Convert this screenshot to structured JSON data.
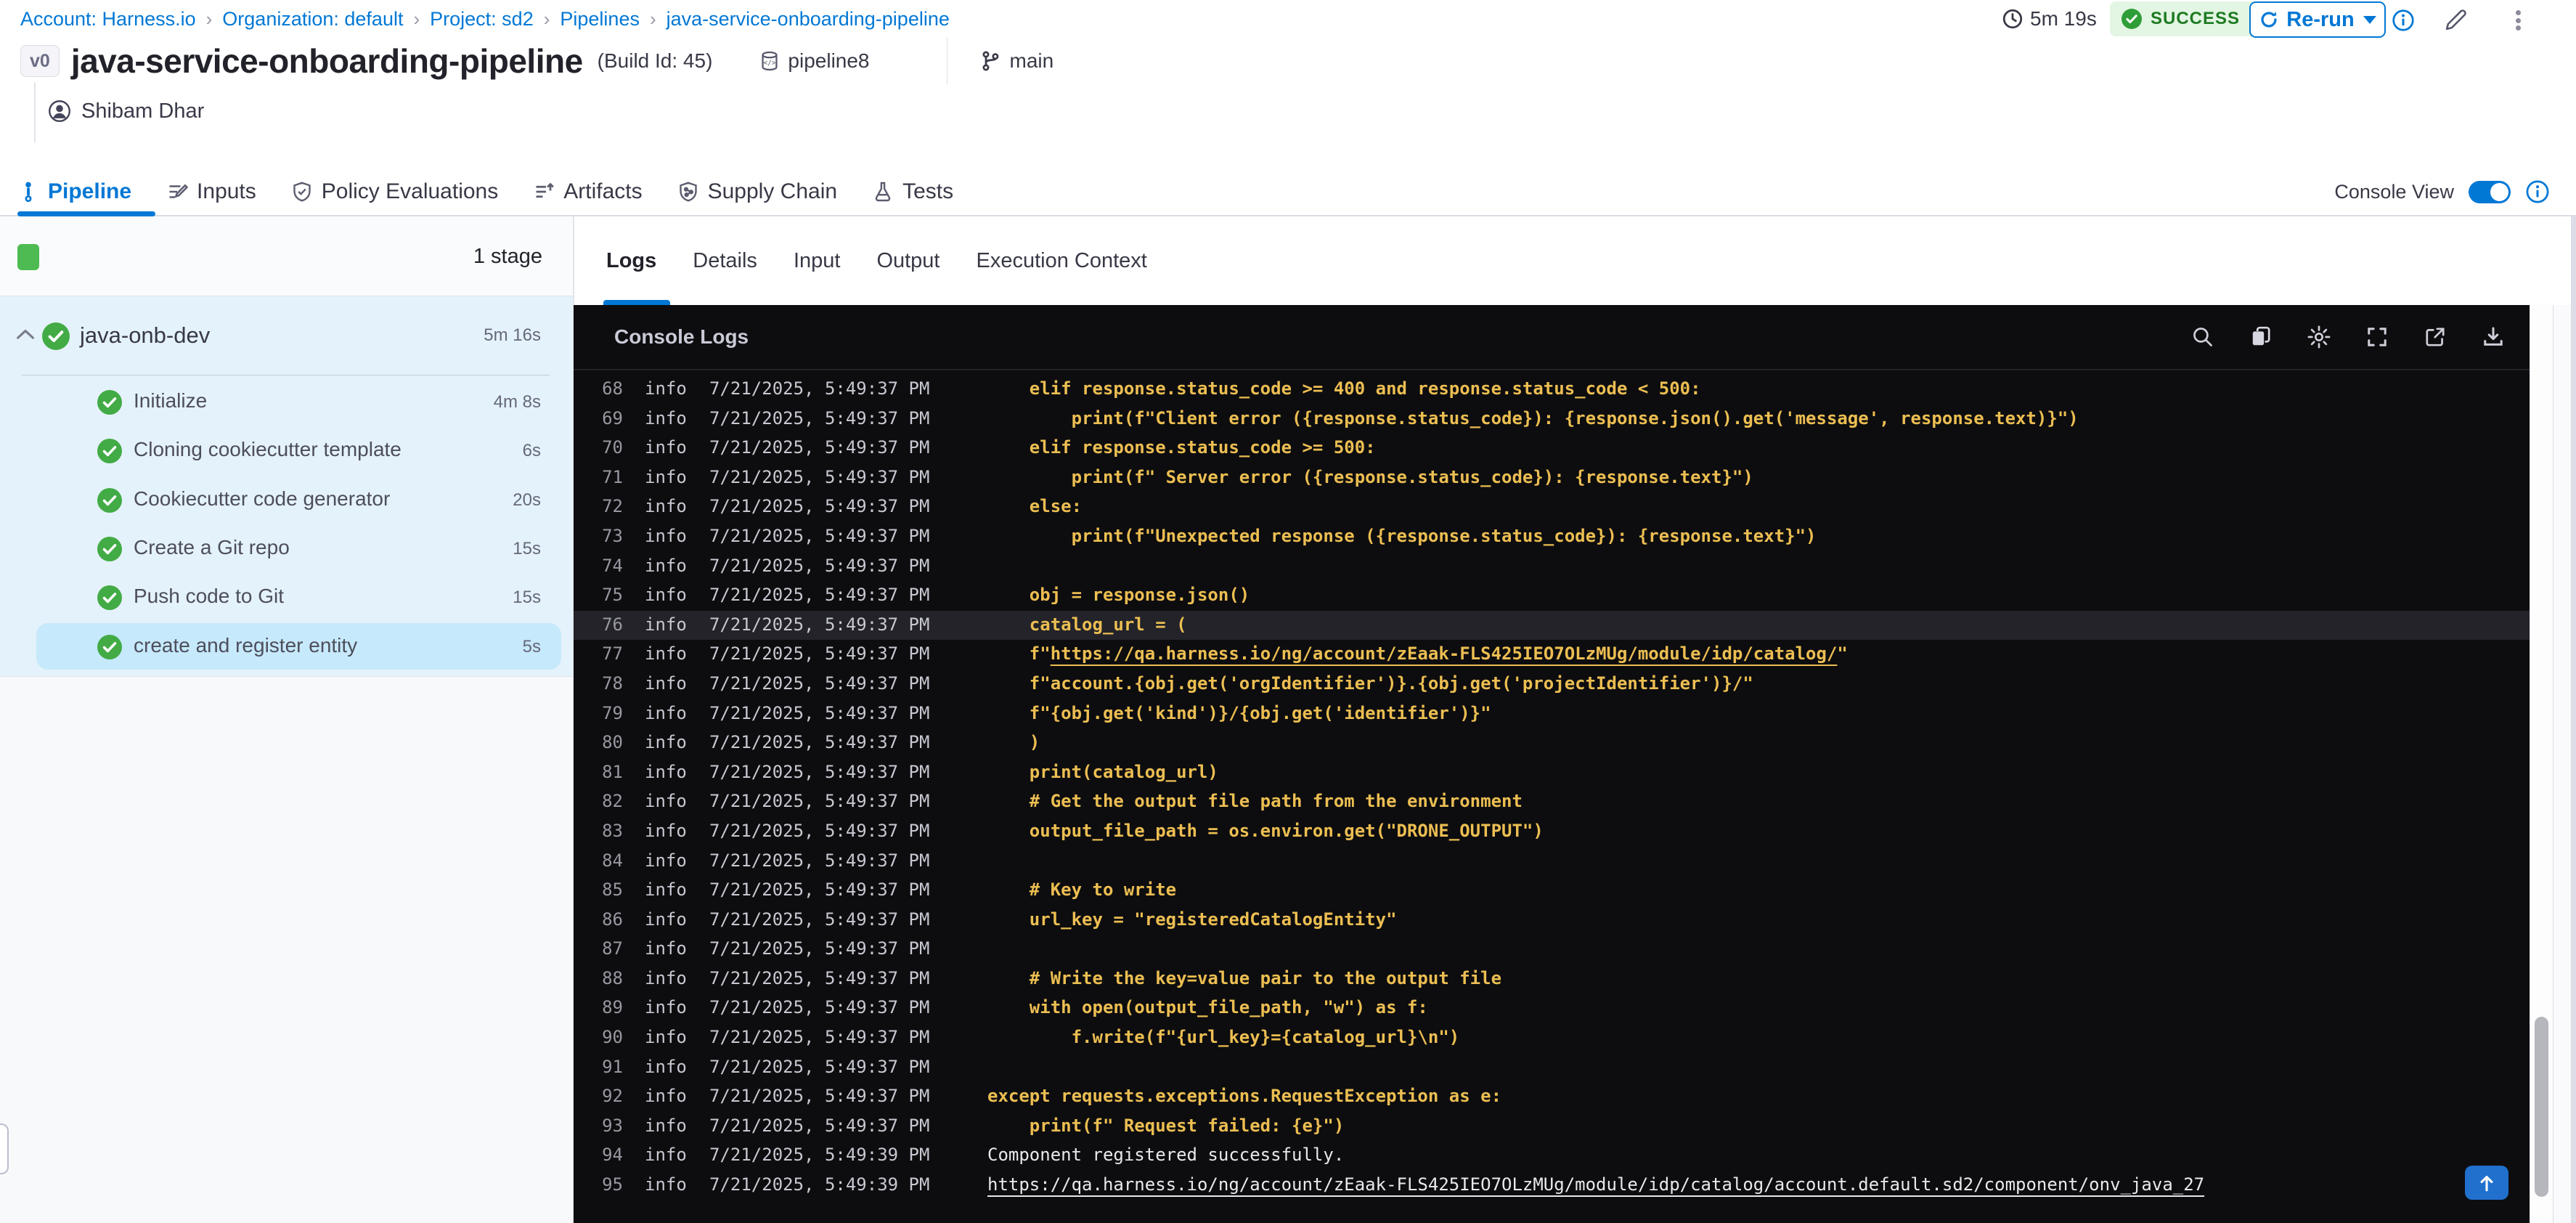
{
  "colors": {
    "accent": "#0278d5",
    "success_green": "#42ab45",
    "status_badge_bg": "#e3f5e3",
    "status_badge_text": "#1e7b22",
    "console_bg": "#0d0d0f",
    "code_amber": "#ecbe52",
    "selected_step_bg": "#c6e9fb",
    "stage_panel_bg": "#e4f2fb"
  },
  "breadcrumb": {
    "items": [
      "Account: Harness.io",
      "Organization: default",
      "Project: sd2",
      "Pipelines",
      "java-service-onboarding-pipeline"
    ],
    "separator": "›"
  },
  "header": {
    "run_duration": "5m 19s",
    "status": "SUCCESS",
    "rerun_label": "Re-run",
    "version_badge": "v0",
    "title": "java-service-onboarding-pipeline",
    "build_id": "(Build Id: 45)",
    "pipeline_ref": "pipeline8",
    "branch": "main",
    "user": "Shibam Dhar",
    "icons": [
      "clock-icon",
      "check-circle-icon",
      "refresh-icon",
      "caret-down-icon",
      "info-icon",
      "edit-pencil-icon",
      "kebab-menu-icon",
      "db-icon",
      "git-branch-icon",
      "user-icon"
    ]
  },
  "tabs": {
    "items": [
      {
        "label": "Pipeline",
        "icon": "pipeline-icon",
        "active": true
      },
      {
        "label": "Inputs",
        "icon": "inputs-icon",
        "active": false
      },
      {
        "label": "Policy Evaluations",
        "icon": "shield-check-icon",
        "active": false
      },
      {
        "label": "Artifacts",
        "icon": "artifacts-icon",
        "active": false
      },
      {
        "label": "Supply Chain",
        "icon": "supply-chain-icon",
        "active": false
      },
      {
        "label": "Tests",
        "icon": "flask-icon",
        "active": false
      }
    ],
    "console_view_label": "Console View",
    "console_view_on": true
  },
  "sidebar": {
    "stage_count_label": "1 stage",
    "stage": {
      "name": "java-onb-dev",
      "duration": "5m 16s",
      "status": "success"
    },
    "steps": [
      {
        "label": "Initialize",
        "duration": "4m 8s",
        "status": "success"
      },
      {
        "label": "Cloning cookiecutter template",
        "duration": "6s",
        "status": "success"
      },
      {
        "label": "Cookiecutter code generator",
        "duration": "20s",
        "status": "success"
      },
      {
        "label": "Create a Git repo",
        "duration": "15s",
        "status": "success"
      },
      {
        "label": "Push code to Git",
        "duration": "15s",
        "status": "success"
      },
      {
        "label": "create and register entity",
        "duration": "5s",
        "status": "success"
      }
    ],
    "selected_step_index": 5
  },
  "log_panel": {
    "tabs": [
      "Logs",
      "Details",
      "Input",
      "Output",
      "Execution Context"
    ],
    "active_tab": "Logs",
    "console_title": "Console Logs",
    "toolbar_icons": [
      "search-icon",
      "copy-icon",
      "settings-gear-icon",
      "fullscreen-icon",
      "open-in-new-icon",
      "download-icon"
    ],
    "scroll_top_icon": "arrow-up-icon"
  },
  "logs": {
    "lines": [
      {
        "n": 68,
        "level": "info",
        "time": "7/21/2025, 5:49:37 PM",
        "text": "    elif response.status_code >= 400 and response.status_code < 500:"
      },
      {
        "n": 69,
        "level": "info",
        "time": "7/21/2025, 5:49:37 PM",
        "text": "        print(f\"Client error ({response.status_code}): {response.json().get('message', response.text)}\")"
      },
      {
        "n": 70,
        "level": "info",
        "time": "7/21/2025, 5:49:37 PM",
        "text": "    elif response.status_code >= 500:"
      },
      {
        "n": 71,
        "level": "info",
        "time": "7/21/2025, 5:49:37 PM",
        "text": "        print(f\" Server error ({response.status_code}): {response.text}\")"
      },
      {
        "n": 72,
        "level": "info",
        "time": "7/21/2025, 5:49:37 PM",
        "text": "    else:"
      },
      {
        "n": 73,
        "level": "info",
        "time": "7/21/2025, 5:49:37 PM",
        "text": "        print(f\"Unexpected response ({response.status_code}): {response.text}\")"
      },
      {
        "n": 74,
        "level": "info",
        "time": "7/21/2025, 5:49:37 PM",
        "text": ""
      },
      {
        "n": 75,
        "level": "info",
        "time": "7/21/2025, 5:49:37 PM",
        "text": "    obj = response.json()"
      },
      {
        "n": 76,
        "level": "info",
        "time": "7/21/2025, 5:49:37 PM",
        "text": "    catalog_url = (",
        "highlight": true
      },
      {
        "n": 77,
        "level": "info",
        "time": "7/21/2025, 5:49:37 PM",
        "segments": [
          {
            "t": "    f\"",
            "link": false
          },
          {
            "t": "https://qa.harness.io/ng/account/zEaak-FLS425IEO7OLzMUg/module/idp/catalog/",
            "link": true
          },
          {
            "t": "\"",
            "link": false
          }
        ]
      },
      {
        "n": 78,
        "level": "info",
        "time": "7/21/2025, 5:49:37 PM",
        "text": "    f\"account.{obj.get('orgIdentifier')}.{obj.get('projectIdentifier')}/\""
      },
      {
        "n": 79,
        "level": "info",
        "time": "7/21/2025, 5:49:37 PM",
        "text": "    f\"{obj.get('kind')}/{obj.get('identifier')}\""
      },
      {
        "n": 80,
        "level": "info",
        "time": "7/21/2025, 5:49:37 PM",
        "text": "    )"
      },
      {
        "n": 81,
        "level": "info",
        "time": "7/21/2025, 5:49:37 PM",
        "text": "    print(catalog_url)"
      },
      {
        "n": 82,
        "level": "info",
        "time": "7/21/2025, 5:49:37 PM",
        "text": "    # Get the output file path from the environment"
      },
      {
        "n": 83,
        "level": "info",
        "time": "7/21/2025, 5:49:37 PM",
        "text": "    output_file_path = os.environ.get(\"DRONE_OUTPUT\")"
      },
      {
        "n": 84,
        "level": "info",
        "time": "7/21/2025, 5:49:37 PM",
        "text": ""
      },
      {
        "n": 85,
        "level": "info",
        "time": "7/21/2025, 5:49:37 PM",
        "text": "    # Key to write"
      },
      {
        "n": 86,
        "level": "info",
        "time": "7/21/2025, 5:49:37 PM",
        "text": "    url_key = \"registeredCatalogEntity\""
      },
      {
        "n": 87,
        "level": "info",
        "time": "7/21/2025, 5:49:37 PM",
        "text": ""
      },
      {
        "n": 88,
        "level": "info",
        "time": "7/21/2025, 5:49:37 PM",
        "text": "    # Write the key=value pair to the output file"
      },
      {
        "n": 89,
        "level": "info",
        "time": "7/21/2025, 5:49:37 PM",
        "text": "    with open(output_file_path, \"w\") as f:"
      },
      {
        "n": 90,
        "level": "info",
        "time": "7/21/2025, 5:49:37 PM",
        "text": "        f.write(f\"{url_key}={catalog_url}\\n\")"
      },
      {
        "n": 91,
        "level": "info",
        "time": "7/21/2025, 5:49:37 PM",
        "text": ""
      },
      {
        "n": 92,
        "level": "info",
        "time": "7/21/2025, 5:49:37 PM",
        "text": "except requests.exceptions.RequestException as e:"
      },
      {
        "n": 93,
        "level": "info",
        "time": "7/21/2025, 5:49:37 PM",
        "text": "    print(f\" Request failed: {e}\")"
      },
      {
        "n": 94,
        "level": "info",
        "time": "7/21/2025, 5:49:39 PM",
        "text": "Component registered successfully.",
        "style": "plain"
      },
      {
        "n": 95,
        "level": "info",
        "time": "7/21/2025, 5:49:39 PM",
        "style": "plain",
        "segments": [
          {
            "t": "https://qa.harness.io/ng/account/zEaak-FLS425IEO7OLzMUg/module/idp/catalog/account.default.sd2/component/onv_java_27",
            "link": true
          }
        ]
      }
    ]
  }
}
